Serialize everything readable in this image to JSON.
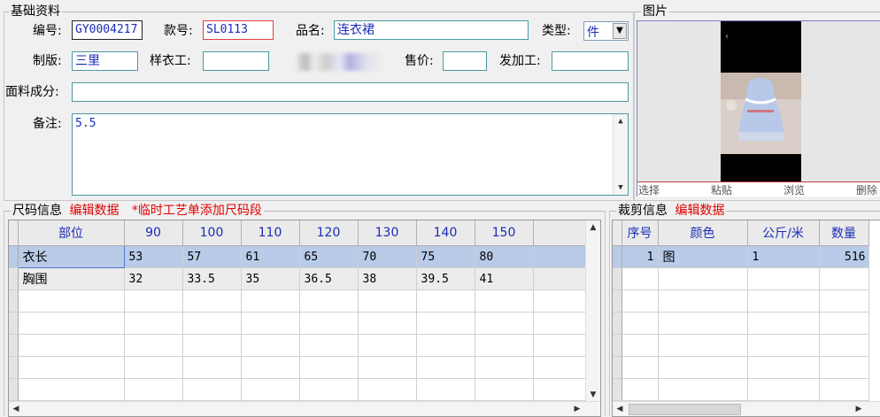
{
  "basic_info": {
    "legend": "基础资料",
    "fields": {
      "code": {
        "label": "编号:",
        "value": "GY0004217"
      },
      "style_no": {
        "label": "款号:",
        "value": "SL0113"
      },
      "product_name": {
        "label": "品名:",
        "value": "连衣裙"
      },
      "type": {
        "label": "类型:",
        "value": "件"
      },
      "pattern_maker": {
        "label": "制版:",
        "value": "三里"
      },
      "sample_worker": {
        "label": "样衣工:",
        "value": ""
      },
      "price": {
        "label": "售价:",
        "value": ""
      },
      "outsource": {
        "label": "发加工:",
        "value": ""
      },
      "fabric": {
        "label": "面料成分:",
        "value": ""
      },
      "remark": {
        "label": "备注:",
        "value": "5.5"
      }
    }
  },
  "image_panel": {
    "legend": "图片",
    "actions": {
      "select": "选择",
      "paste": "粘贴",
      "browse": "浏览",
      "delete": "删除"
    }
  },
  "size_info": {
    "legend": "尺码信息",
    "edit_link": "编辑数据",
    "note": "*临时工艺单添加尺码段",
    "columns": [
      "部位",
      "90",
      "100",
      "110",
      "120",
      "130",
      "140",
      "150"
    ],
    "rows": [
      [
        "衣长",
        "53",
        "57",
        "61",
        "65",
        "70",
        "75",
        "80"
      ],
      [
        "胸围",
        "32",
        "33.5",
        "35",
        "36.5",
        "38",
        "39.5",
        "41"
      ]
    ]
  },
  "cut_info": {
    "legend": "裁剪信息",
    "edit_link": "编辑数据",
    "columns": [
      "序号",
      "颜色",
      "公斤/米",
      "数量"
    ],
    "rows": [
      [
        "1",
        "图",
        "1",
        "516"
      ]
    ]
  },
  "colors": {
    "accent_text": "#1a2bb8",
    "warning_text": "#e00000",
    "selected_row": "#b8cbe8"
  }
}
